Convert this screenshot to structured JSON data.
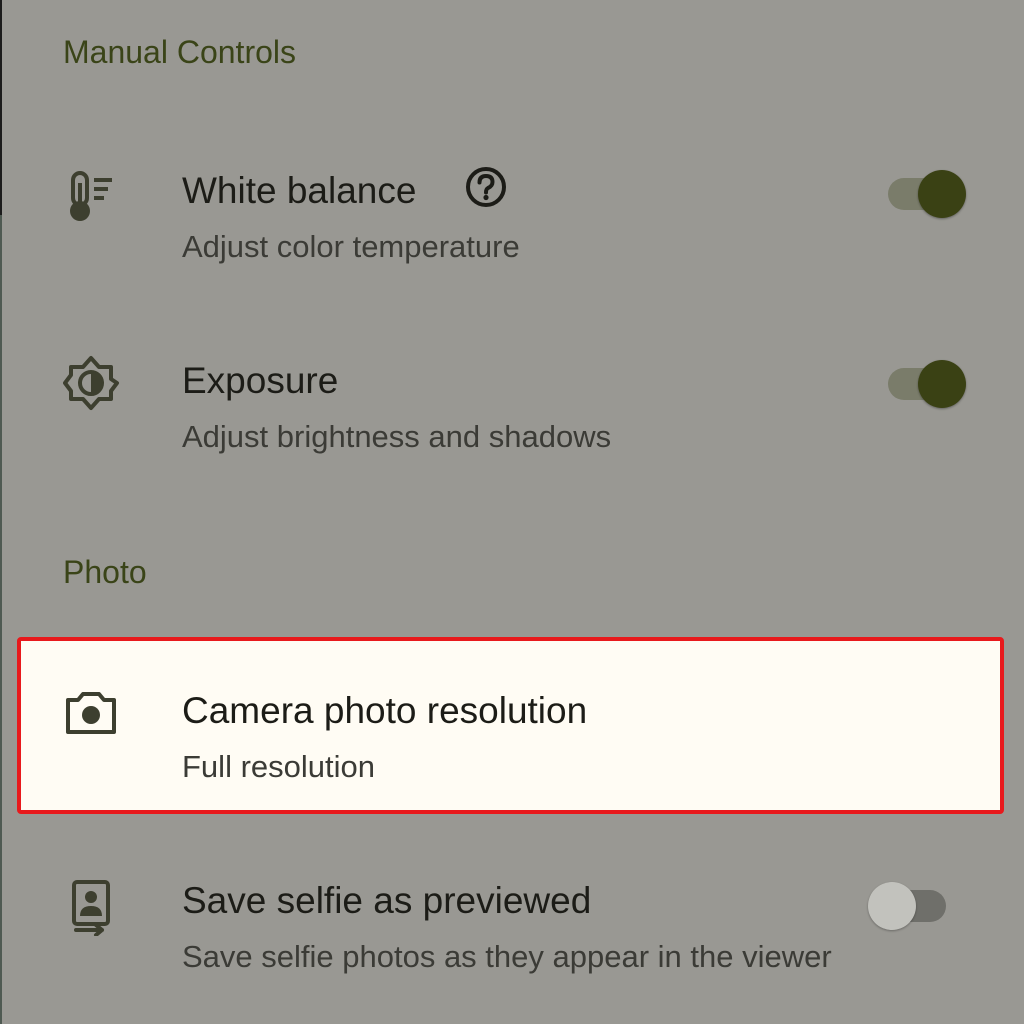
{
  "sections": {
    "manual_controls": "Manual Controls",
    "photo": "Photo"
  },
  "rows": {
    "white_balance": {
      "title": "White balance",
      "subtitle": "Adjust color temperature",
      "icon": "thermometer-icon",
      "toggle": "on"
    },
    "exposure": {
      "title": "Exposure",
      "subtitle": "Adjust brightness and shadows",
      "icon": "exposure-icon",
      "toggle": "on"
    },
    "camera_resolution": {
      "title": "Camera photo resolution",
      "subtitle": "Full resolution",
      "icon": "camera-icon"
    },
    "save_selfie": {
      "title": "Save selfie as previewed",
      "subtitle": "Save selfie photos as they appear in the viewer",
      "icon": "selfie-icon",
      "toggle": "off"
    }
  },
  "colors": {
    "scrim": "#999893",
    "accent": "#3a4114",
    "highlight_border": "#e8191c",
    "highlight_bg": "#fffcf4"
  }
}
